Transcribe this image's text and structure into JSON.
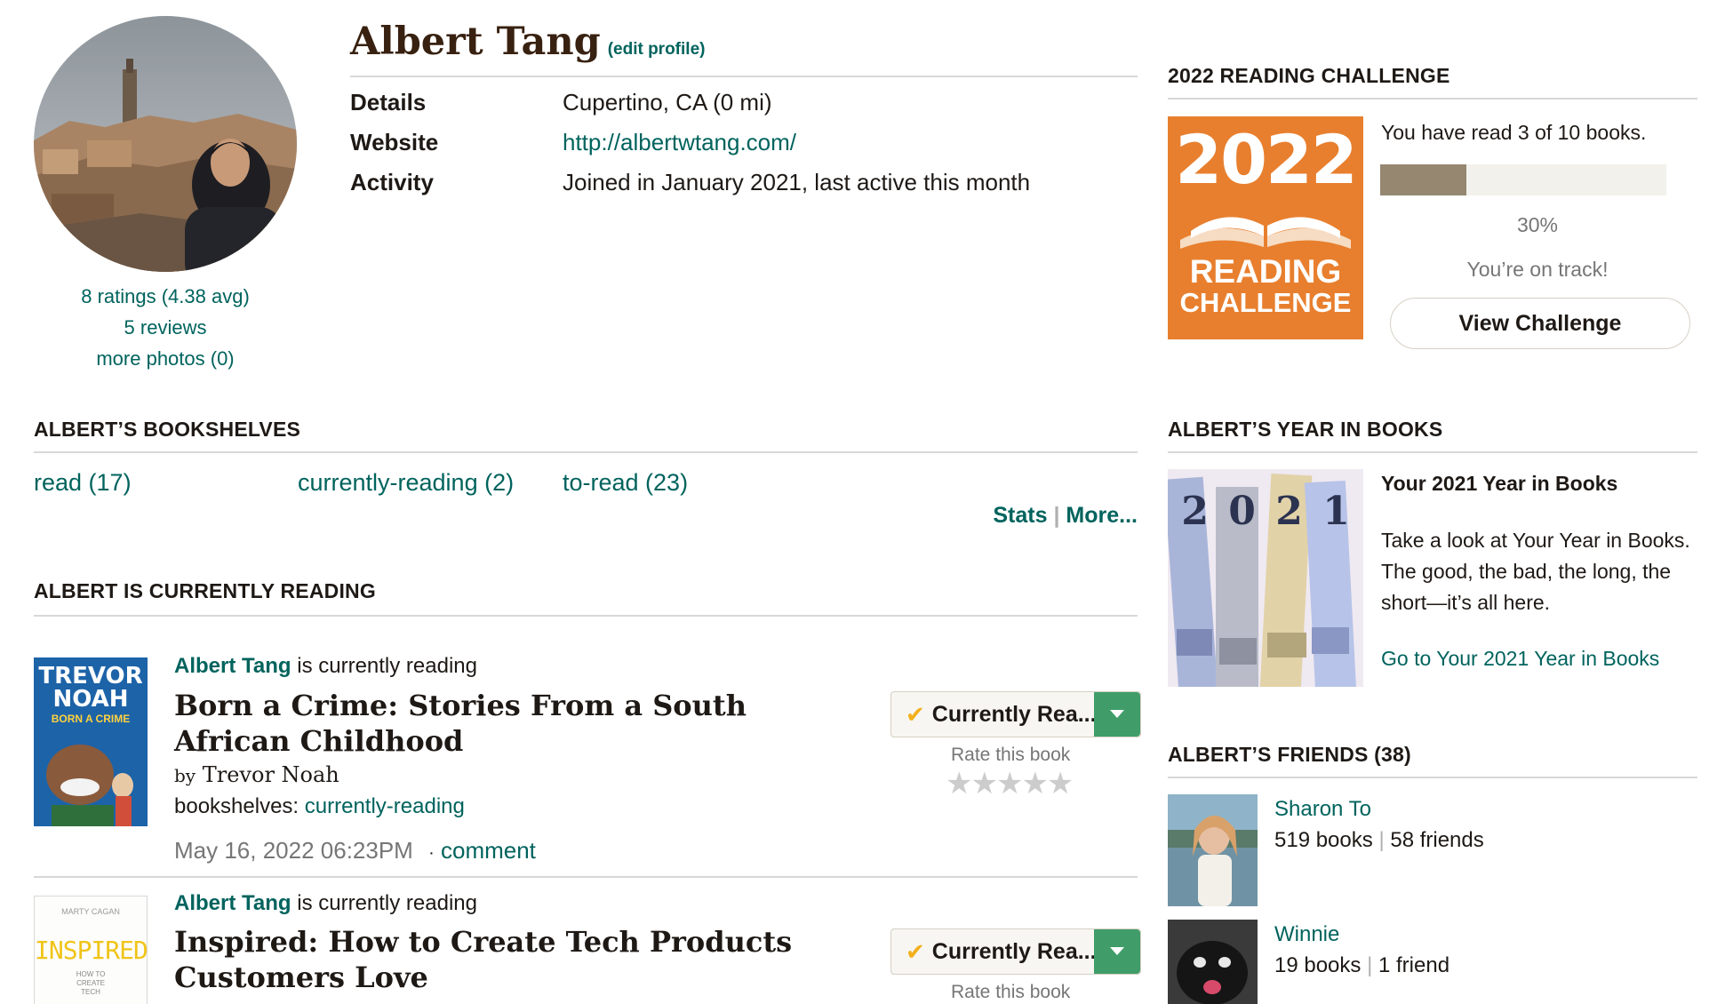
{
  "profile": {
    "name": "Albert Tang",
    "edit_profile": "(edit profile)",
    "ratings": "8 ratings (4.38 avg)",
    "reviews": "5 reviews",
    "more_photos": "more photos (0)",
    "details_label": "Details",
    "details_value": "Cupertino, CA (0 mi)",
    "website_label": "Website",
    "website_value": "http://albertwtang.com/",
    "activity_label": "Activity",
    "activity_value": "Joined in January 2021, last active this month"
  },
  "bookshelves": {
    "header": "ALBERT’S BOOKSHELVES",
    "shelves": [
      "read (17)",
      "currently-reading (2)",
      "to-read (23)"
    ],
    "stats": "Stats",
    "separator": "|",
    "more": "More..."
  },
  "currently_reading": {
    "header": "ALBERT IS CURRENTLY READING",
    "items": [
      {
        "reader": "Albert Tang",
        "action": "is currently reading",
        "title": "Born a Crime: Stories From a South African Childhood",
        "by": "by",
        "author": "Trevor Noah",
        "shelves_label": "bookshelves:",
        "shelf": "currently-reading",
        "date": "May 16, 2022 06:23PM",
        "dot": "·",
        "comment": "comment",
        "status": "Currently Rea...",
        "rate_label": "Rate this book",
        "stars": "★★★★★",
        "cover_line1": "TREVOR",
        "cover_line2": "NOAH",
        "cover_line3": "BORN A CRIME"
      },
      {
        "reader": "Albert Tang",
        "action": "is currently reading",
        "title": "Inspired: How to Create Tech Products Customers Love",
        "status": "Currently Rea...",
        "rate_label": "Rate this book",
        "cover_author": "MARTY CAGAN",
        "cover_title": "INSPIRED",
        "cover_sub1": "HOW TO",
        "cover_sub2": "CREATE",
        "cover_sub3": "TECH"
      }
    ]
  },
  "challenge": {
    "header": "2022 READING CHALLENGE",
    "badge_year": "2022",
    "badge_line1": "READING",
    "badge_line2": "CHALLENGE",
    "progress_text": "You have read 3 of 10 books.",
    "progress_fraction": 0.3,
    "percent": "30%",
    "track_text": "You’re on track!",
    "button": "View Challenge"
  },
  "year_in_books": {
    "header": "ALBERT’S YEAR IN BOOKS",
    "title": "Your 2021 Year in Books",
    "desc1": "Take a look at Your Year in Books.",
    "desc2": "The good, the bad, the long, the",
    "desc3": "short—it’s all here.",
    "link": "Go to Your 2021 Year in Books",
    "digits": [
      "2",
      "0",
      "2",
      "1"
    ]
  },
  "friends": {
    "header": "ALBERT’S FRIENDS (38)",
    "separator": "|",
    "items": [
      {
        "name": "Sharon To",
        "books": "519 books",
        "friends": "58 friends"
      },
      {
        "name": "Winnie",
        "books": "19 books",
        "friends": "1 friend"
      }
    ]
  },
  "colors": {
    "link": "#00635d",
    "brown": "#382110",
    "challenge_orange": "#e87f2e",
    "progress_fill": "#958770",
    "status_green": "#409d69"
  }
}
